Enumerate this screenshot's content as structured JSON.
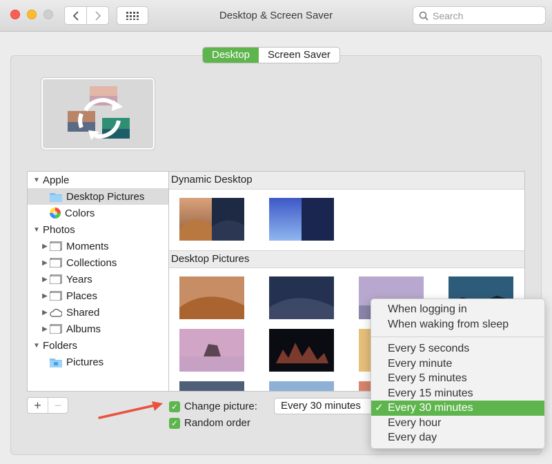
{
  "window": {
    "title": "Desktop & Screen Saver"
  },
  "search": {
    "placeholder": "Search"
  },
  "tabs": [
    {
      "label": "Desktop",
      "active": true
    },
    {
      "label": "Screen Saver",
      "active": false
    }
  ],
  "sidebar": {
    "items": [
      {
        "label": "Apple",
        "level": 0,
        "disclosure": "expanded",
        "icon": ""
      },
      {
        "label": "Desktop Pictures",
        "level": 1,
        "icon": "folder-icon",
        "selected": true
      },
      {
        "label": "Colors",
        "level": 1,
        "icon": "color-wheel-icon"
      },
      {
        "label": "Photos",
        "level": 0,
        "disclosure": "expanded",
        "icon": ""
      },
      {
        "label": "Moments",
        "level": 1,
        "disclosure": "collapsed",
        "icon": "photo-stack-icon"
      },
      {
        "label": "Collections",
        "level": 1,
        "disclosure": "collapsed",
        "icon": "photo-stack-icon"
      },
      {
        "label": "Years",
        "level": 1,
        "disclosure": "collapsed",
        "icon": "photo-stack-icon"
      },
      {
        "label": "Places",
        "level": 1,
        "disclosure": "collapsed",
        "icon": "photo-stack-icon"
      },
      {
        "label": "Shared",
        "level": 1,
        "disclosure": "collapsed",
        "icon": "cloud-icon"
      },
      {
        "label": "Albums",
        "level": 1,
        "disclosure": "collapsed",
        "icon": "photo-stack-icon"
      },
      {
        "label": "Folders",
        "level": 0,
        "disclosure": "expanded",
        "icon": ""
      },
      {
        "label": "Pictures",
        "level": 1,
        "icon": "pictures-folder-icon"
      }
    ]
  },
  "gallery": {
    "sections": [
      {
        "title": "Dynamic Desktop"
      },
      {
        "title": "Desktop Pictures"
      }
    ]
  },
  "bottom": {
    "add_label": "+",
    "remove_label": "−",
    "change_picture": {
      "label": "Change picture:",
      "checked": true
    },
    "random_order": {
      "label": "Random order",
      "checked": true
    },
    "interval_value": "Every 30 minutes"
  },
  "interval_menu": {
    "group1": [
      "When logging in",
      "When waking from sleep"
    ],
    "group2": [
      "Every 5 seconds",
      "Every minute",
      "Every 5 minutes",
      "Every 15 minutes",
      "Every 30 minutes",
      "Every hour",
      "Every day"
    ],
    "selected": "Every 30 minutes",
    "check_glyph": "✓"
  },
  "colors": {
    "accent": "#5fb54d",
    "arrow": "#e8533f"
  }
}
